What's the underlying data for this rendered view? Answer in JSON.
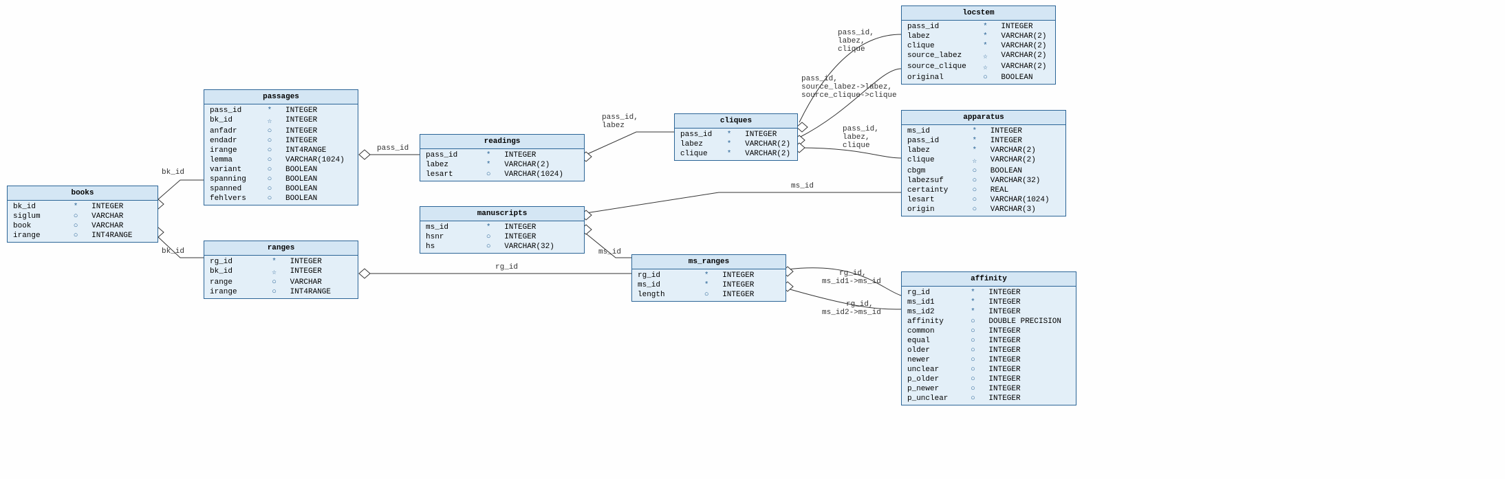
{
  "tables": {
    "books": {
      "title": "books",
      "rows": [
        {
          "name": "bk_id",
          "key": "*",
          "type": "INTEGER"
        },
        {
          "name": "siglum",
          "key": "○",
          "type": "VARCHAR"
        },
        {
          "name": "book",
          "key": "○",
          "type": "VARCHAR"
        },
        {
          "name": "irange",
          "key": "○",
          "type": "INT4RANGE"
        }
      ]
    },
    "passages": {
      "title": "passages",
      "rows": [
        {
          "name": "pass_id",
          "key": "*",
          "type": "INTEGER"
        },
        {
          "name": "bk_id",
          "key": "☆",
          "type": "INTEGER"
        },
        {
          "name": "anfadr",
          "key": "○",
          "type": "INTEGER"
        },
        {
          "name": "endadr",
          "key": "○",
          "type": "INTEGER"
        },
        {
          "name": "irange",
          "key": "○",
          "type": "INT4RANGE"
        },
        {
          "name": "lemma",
          "key": "○",
          "type": "VARCHAR(1024)"
        },
        {
          "name": "variant",
          "key": "○",
          "type": "BOOLEAN"
        },
        {
          "name": "spanning",
          "key": "○",
          "type": "BOOLEAN"
        },
        {
          "name": "spanned",
          "key": "○",
          "type": "BOOLEAN"
        },
        {
          "name": "fehlvers",
          "key": "○",
          "type": "BOOLEAN"
        }
      ]
    },
    "ranges": {
      "title": "ranges",
      "rows": [
        {
          "name": "rg_id",
          "key": "*",
          "type": "INTEGER"
        },
        {
          "name": "bk_id",
          "key": "☆",
          "type": "INTEGER"
        },
        {
          "name": "range",
          "key": "○",
          "type": "VARCHAR"
        },
        {
          "name": "irange",
          "key": "○",
          "type": "INT4RANGE"
        }
      ]
    },
    "readings": {
      "title": "readings",
      "rows": [
        {
          "name": "pass_id",
          "key": "*",
          "type": "INTEGER"
        },
        {
          "name": "labez",
          "key": "*",
          "type": "VARCHAR(2)"
        },
        {
          "name": "lesart",
          "key": "○",
          "type": "VARCHAR(1024)"
        }
      ]
    },
    "manuscripts": {
      "title": "manuscripts",
      "rows": [
        {
          "name": "ms_id",
          "key": "*",
          "type": "INTEGER"
        },
        {
          "name": "hsnr",
          "key": "○",
          "type": "INTEGER"
        },
        {
          "name": "hs",
          "key": "○",
          "type": "VARCHAR(32)"
        }
      ]
    },
    "cliques": {
      "title": "cliques",
      "rows": [
        {
          "name": "pass_id",
          "key": "*",
          "type": "INTEGER"
        },
        {
          "name": "labez",
          "key": "*",
          "type": "VARCHAR(2)"
        },
        {
          "name": "clique",
          "key": "*",
          "type": "VARCHAR(2)"
        }
      ]
    },
    "ms_ranges": {
      "title": "ms_ranges",
      "rows": [
        {
          "name": "rg_id",
          "key": "*",
          "type": "INTEGER"
        },
        {
          "name": "ms_id",
          "key": "*",
          "type": "INTEGER"
        },
        {
          "name": "length",
          "key": "○",
          "type": "INTEGER"
        }
      ]
    },
    "locstem": {
      "title": "locstem",
      "rows": [
        {
          "name": "pass_id",
          "key": "*",
          "type": "INTEGER"
        },
        {
          "name": "labez",
          "key": "*",
          "type": "VARCHAR(2)"
        },
        {
          "name": "clique",
          "key": "*",
          "type": "VARCHAR(2)"
        },
        {
          "name": "source_labez",
          "key": "☆",
          "type": "VARCHAR(2)"
        },
        {
          "name": "source_clique",
          "key": "☆",
          "type": "VARCHAR(2)"
        },
        {
          "name": "original",
          "key": "○",
          "type": "BOOLEAN"
        }
      ]
    },
    "apparatus": {
      "title": "apparatus",
      "rows": [
        {
          "name": "ms_id",
          "key": "*",
          "type": "INTEGER"
        },
        {
          "name": "pass_id",
          "key": "*",
          "type": "INTEGER"
        },
        {
          "name": "labez",
          "key": "*",
          "type": "VARCHAR(2)"
        },
        {
          "name": "clique",
          "key": "☆",
          "type": "VARCHAR(2)"
        },
        {
          "name": "cbgm",
          "key": "○",
          "type": "BOOLEAN"
        },
        {
          "name": "labezsuf",
          "key": "○",
          "type": "VARCHAR(32)"
        },
        {
          "name": "certainty",
          "key": "○",
          "type": "REAL"
        },
        {
          "name": "lesart",
          "key": "○",
          "type": "VARCHAR(1024)"
        },
        {
          "name": "origin",
          "key": "○",
          "type": "VARCHAR(3)"
        }
      ]
    },
    "affinity": {
      "title": "affinity",
      "rows": [
        {
          "name": "rg_id",
          "key": "*",
          "type": "INTEGER"
        },
        {
          "name": "ms_id1",
          "key": "*",
          "type": "INTEGER"
        },
        {
          "name": "ms_id2",
          "key": "*",
          "type": "INTEGER"
        },
        {
          "name": "affinity",
          "key": "○",
          "type": "DOUBLE PRECISION"
        },
        {
          "name": "common",
          "key": "○",
          "type": "INTEGER"
        },
        {
          "name": "equal",
          "key": "○",
          "type": "INTEGER"
        },
        {
          "name": "older",
          "key": "○",
          "type": "INTEGER"
        },
        {
          "name": "newer",
          "key": "○",
          "type": "INTEGER"
        },
        {
          "name": "unclear",
          "key": "○",
          "type": "INTEGER"
        },
        {
          "name": "p_older",
          "key": "○",
          "type": "INTEGER"
        },
        {
          "name": "p_newer",
          "key": "○",
          "type": "INTEGER"
        },
        {
          "name": "p_unclear",
          "key": "○",
          "type": "INTEGER"
        }
      ]
    }
  },
  "edges": {
    "bk_id_1": "bk_id",
    "bk_id_2": "bk_id",
    "pass_id": "pass_id",
    "rg_id": "rg_id",
    "pass_id_labez": "pass_id,\nlabez",
    "ms_id_1": "ms_id",
    "ms_id_2": "ms_id",
    "pass_id_labez_clique_1": "pass_id,\nlabez,\nclique",
    "pass_id_labez_clique_2": "pass_id,\nlabez,\nclique",
    "pass_id_source": "pass_id,\nsource_labez->labez,\nsource_clique->clique",
    "rg_ms1": "rg_id,\nms_id1->ms_id",
    "rg_ms2": "rg_id,\nms_id2->ms_id"
  }
}
